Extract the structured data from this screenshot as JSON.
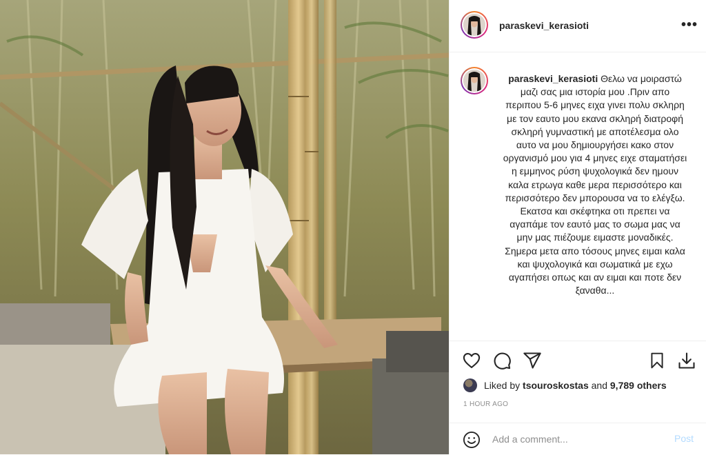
{
  "post": {
    "photo": {
      "alt": "",
      "icon": "photo"
    },
    "header": {
      "username": "paraskevi_kerasioti",
      "more_icon": "more-horizontal-icon",
      "more_label": "•••"
    },
    "caption": {
      "username": "paraskevi_kerasioti",
      "text": "Θελω να μοιραστώ μαζι σας μια ιστορία μου .Πριν απο περιπου 5-6 μηνες ειχα γινει πολυ σκληρη με τον εαυτο μου εκανα σκληρή διατροφή σκληρή γυμναστική με αποτέλεσμα ολο αυτο να μου δημιουργήσει κακο στον οργανισμό μου για 4 μηνες ειχε σταματήσει η εμμηνος ρύση ψυχολογικά δεν ημουν καλα ετρωγα καθε μερα περισσότερο και περισσότερο δεν μπορουσα να το ελέγξω. Εκατσα και σκέφτηκα οτι πρεπει να αγαπάμε τον εαυτό μας το σωμα μας να μην μας πιέζουμε ειμαστε μοναδικές. Σημερα μετα απο τόσους μηνες ειμαι καλα και ψυχολογικά και σωματικά με εχω αγαπήσει οπως και αν ειμαι και ποτε δεν ξαναθα..."
    },
    "actions": {
      "like_icon": "heart-icon",
      "comment_icon": "comment-icon",
      "share_icon": "paper-plane-icon",
      "save_icon": "bookmark-icon",
      "download_icon": "download-icon"
    },
    "likes": {
      "prefix": "Liked by ",
      "first_user": "tsouroskostas",
      "middle": " and ",
      "others": "9,789 others"
    },
    "timestamp": "1 HOUR AGO",
    "comment_box": {
      "emoji_icon": "smiley-icon",
      "placeholder": "Add a comment...",
      "post_label": "Post"
    },
    "colors": {
      "text": "#262626",
      "muted": "#8e8e8e",
      "post_disabled": "#b3dbff",
      "border": "#efefef"
    }
  }
}
